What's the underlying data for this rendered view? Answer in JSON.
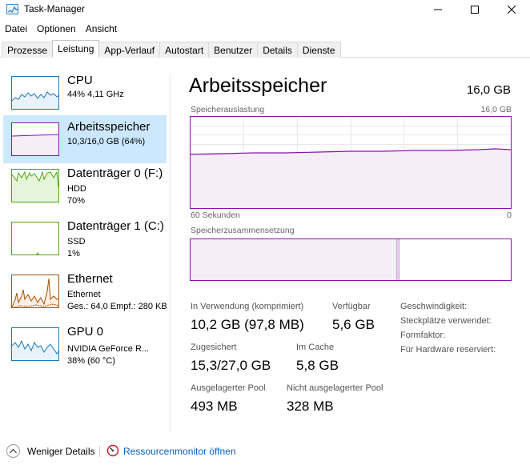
{
  "window": {
    "title": "Task-Manager",
    "min_icon": "minimize-icon",
    "max_icon": "maximize-icon",
    "close_icon": "close-icon"
  },
  "menu": [
    "Datei",
    "Optionen",
    "Ansicht"
  ],
  "tabs": [
    "Prozesse",
    "Leistung",
    "App-Verlauf",
    "Autostart",
    "Benutzer",
    "Details",
    "Dienste"
  ],
  "active_tab": "Leistung",
  "sidebar": [
    {
      "name": "CPU",
      "line1": "44% 4,11 GHz",
      "line2": "",
      "line3": "",
      "color": "#1779ba"
    },
    {
      "name": "Arbeitsspeicher",
      "line1": "10,3/16,0 GB (64%)",
      "line2": "",
      "line3": "",
      "color": "#8b12ae"
    },
    {
      "name": "Datenträger 0 (F:)",
      "line1": "HDD",
      "line2": "70%",
      "line3": "",
      "color": "#4da60c"
    },
    {
      "name": "Datenträger 1 (C:)",
      "line1": "SSD",
      "line2": "1%",
      "line3": "",
      "color": "#4da60c"
    },
    {
      "name": "Ethernet",
      "line1": "Ethernet",
      "line2": "Ges.: 64,0  Empf.: 280 KB",
      "line3": "",
      "color": "#a74f01"
    },
    {
      "name": "GPU 0",
      "line1": "NVIDIA GeForce R...",
      "line2": "38% (60 °C)",
      "line3": "",
      "color": "#1779ba"
    }
  ],
  "main": {
    "title": "Arbeitsspeicher",
    "total": "16,0 GB",
    "usage_label": "Speicherauslastung",
    "usage_max": "16,0 GB",
    "time_left": "60 Sekunden",
    "time_right": "0",
    "composition_label": "Speicherzusammensetzung",
    "usage_percent": 64,
    "stats": {
      "in_use_label": "In Verwendung (komprimiert)",
      "in_use_value": "10,2 GB (97,8 MB)",
      "available_label": "Verfügbar",
      "available_value": "5,6 GB",
      "committed_label": "Zugesichert",
      "committed_value": "15,3/27,0 GB",
      "cached_label": "Im Cache",
      "cached_value": "5,8 GB",
      "paged_label": "Ausgelagerter Pool",
      "paged_value": "493 MB",
      "nonpaged_label": "Nicht ausgelagerter Pool",
      "nonpaged_value": "328 MB"
    },
    "side": {
      "speed": "Geschwindigkeit:",
      "slots": "Steckplätze verwendet:",
      "form": "Formfaktor:",
      "reserved": "Für Hardware reserviert:"
    }
  },
  "bottom": {
    "less_details": "Weniger Details",
    "resource_monitor": "Ressourcenmonitor öffnen"
  }
}
